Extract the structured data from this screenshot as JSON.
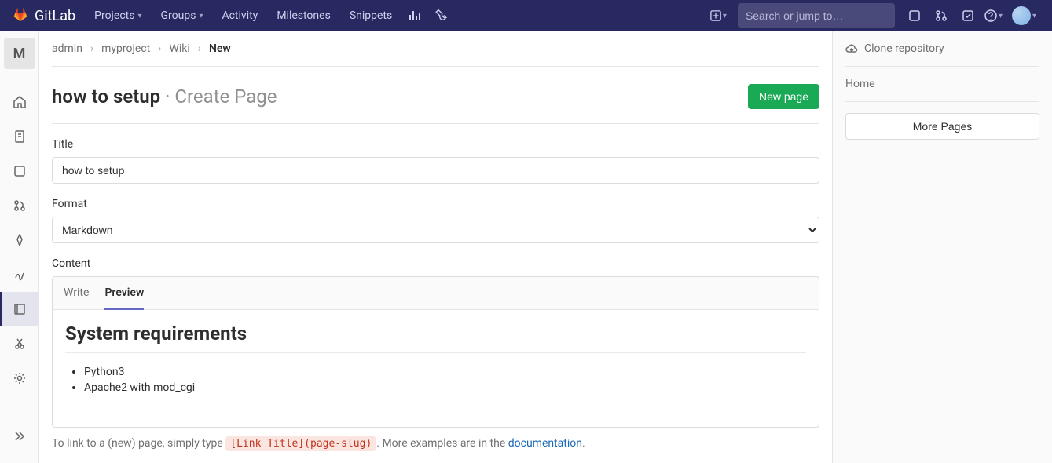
{
  "brand": "GitLab",
  "nav": {
    "projects": "Projects",
    "groups": "Groups",
    "activity": "Activity",
    "milestones": "Milestones",
    "snippets": "Snippets"
  },
  "search_placeholder": "Search or jump to…",
  "sidebar": {
    "project_letter": "M"
  },
  "breadcrumb": {
    "admin": "admin",
    "project": "myproject",
    "wiki": "Wiki",
    "current": "New"
  },
  "title": {
    "name": "how to setup",
    "action": "· Create Page"
  },
  "buttons": {
    "new_page": "New page",
    "more_pages": "More Pages"
  },
  "form": {
    "title_label": "Title",
    "title_value": "how to setup",
    "format_label": "Format",
    "format_value": "Markdown",
    "content_label": "Content"
  },
  "editor": {
    "tab_write": "Write",
    "tab_preview": "Preview",
    "preview_heading": "System requirements",
    "preview_items": [
      "Python3",
      "Apache2 with mod_cgi"
    ]
  },
  "hint": {
    "prefix": "To link to a (new) page, simply type ",
    "code": "[Link Title](page-slug)",
    "middle": ". More examples are in the ",
    "link": "documentation",
    "suffix": "."
  },
  "right": {
    "clone": "Clone repository",
    "home": "Home"
  }
}
